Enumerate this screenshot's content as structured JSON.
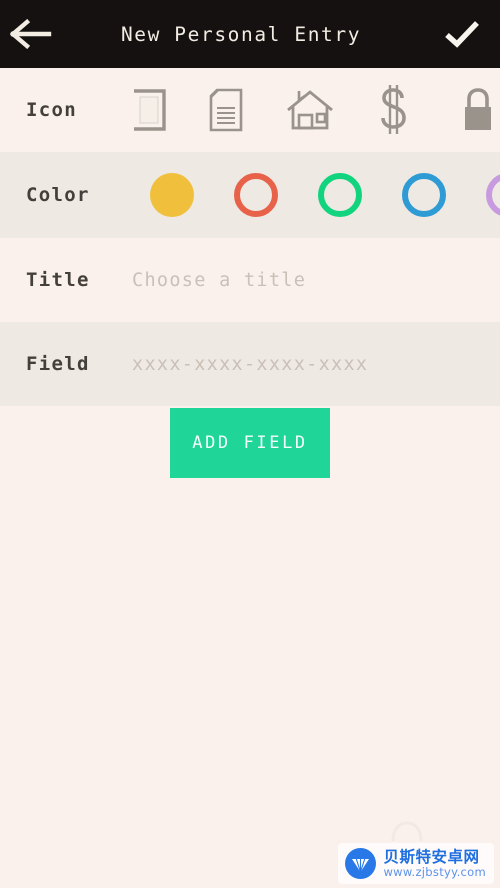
{
  "appbar": {
    "back_icon": "arrow-left-icon",
    "title": "New Personal Entry",
    "confirm_icon": "checkmark-icon",
    "background": "#141110",
    "foreground": "#f3ece3"
  },
  "icon_row": {
    "label": "Icon",
    "icon_color": "#9a938c",
    "items": [
      {
        "name": "card-icon",
        "selected": false,
        "clipped": true
      },
      {
        "name": "document-icon",
        "selected": false,
        "clipped": false
      },
      {
        "name": "house-icon",
        "selected": false,
        "clipped": false
      },
      {
        "name": "dollar-icon",
        "selected": false,
        "clipped": false
      },
      {
        "name": "lock-icon",
        "selected": false,
        "clipped": false
      }
    ]
  },
  "color_row": {
    "label": "Color",
    "items": [
      {
        "name": "color-yellow",
        "hex": "#f0c03c",
        "selected": true,
        "clipped": false
      },
      {
        "name": "color-red",
        "hex": "#e8624a",
        "selected": false,
        "clipped": false
      },
      {
        "name": "color-green",
        "hex": "#12d47e",
        "selected": false,
        "clipped": false
      },
      {
        "name": "color-blue",
        "hex": "#2e9bd4",
        "selected": false,
        "clipped": false
      },
      {
        "name": "color-purple",
        "hex": "#c89be0",
        "selected": false,
        "clipped": true
      }
    ]
  },
  "title_row": {
    "label": "Title",
    "placeholder": "Choose a title",
    "value": ""
  },
  "field_row": {
    "label": "Field",
    "placeholder": "xxxx-xxxx-xxxx-xxxx",
    "value": ""
  },
  "add_field_button": {
    "label": "ADD FIELD",
    "background": "#1fd698",
    "foreground": "#f4fffb"
  },
  "watermark": {
    "title": "贝斯特安卓网",
    "url": "www.zjbstyy.com"
  }
}
